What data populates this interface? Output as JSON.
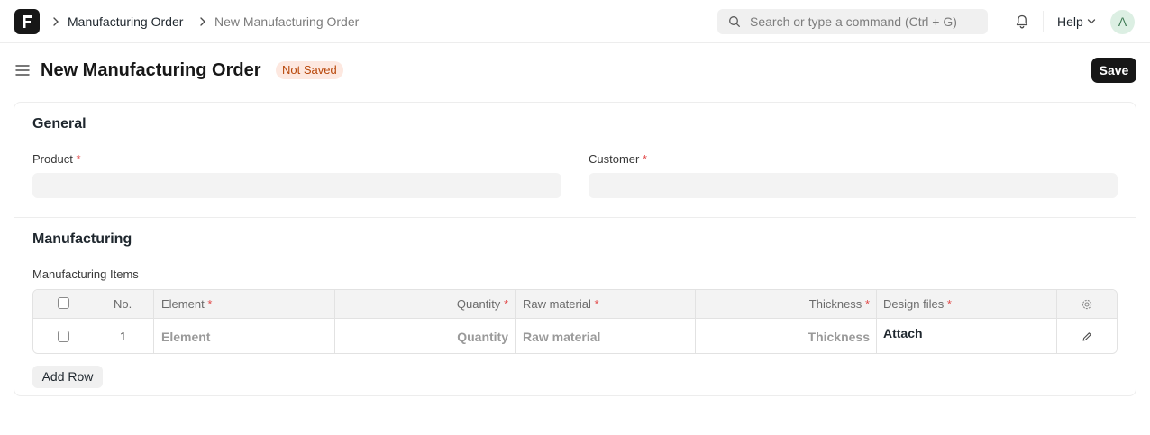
{
  "navbar": {
    "logo_letter": "F",
    "breadcrumbs": [
      "Manufacturing Order",
      "New Manufacturing Order"
    ],
    "search_placeholder": "Search or type a command (Ctrl + G)",
    "help_label": "Help",
    "avatar_initial": "A"
  },
  "page": {
    "title": "New Manufacturing Order",
    "status": "Not Saved",
    "save_label": "Save"
  },
  "form": {
    "general": {
      "title": "General",
      "product_label": "Product",
      "customer_label": "Customer",
      "required_mark": "*"
    },
    "manufacturing": {
      "title": "Manufacturing",
      "items_label": "Manufacturing Items",
      "columns": {
        "no": "No.",
        "element": "Element",
        "quantity": "Quantity",
        "raw_material": "Raw material",
        "thickness": "Thickness",
        "design_files": "Design files"
      },
      "row": {
        "no": "1",
        "element": "Element",
        "quantity": "Quantity",
        "raw_material": "Raw material",
        "thickness": "Thickness",
        "design_files": "Attach"
      },
      "add_row_label": "Add Row"
    }
  },
  "colors": {
    "brand_dark": "#171717",
    "badge_bg": "#fde8e0",
    "badge_text": "#b8480b",
    "required": "#e24c4c"
  }
}
